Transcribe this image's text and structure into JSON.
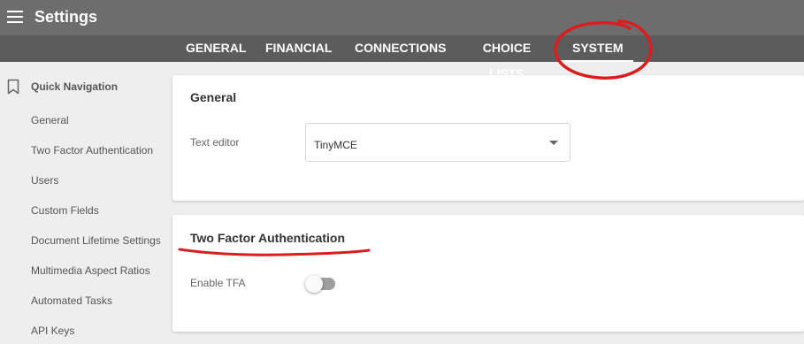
{
  "app": {
    "title": "Settings",
    "menu_icon": "hamburger-menu-icon"
  },
  "tabs": [
    {
      "label": "GENERAL",
      "active": false
    },
    {
      "label": "FINANCIAL",
      "active": false
    },
    {
      "label": "CONNECTIONS",
      "active": false
    },
    {
      "label": "CHOICE LISTS",
      "active": false
    },
    {
      "label": "SYSTEM",
      "active": true
    }
  ],
  "sidebar": {
    "header": {
      "label": "Quick Navigation",
      "icon": "bookmark-icon"
    },
    "items": [
      {
        "label": "General"
      },
      {
        "label": "Two Factor Authentication"
      },
      {
        "label": "Users"
      },
      {
        "label": "Custom Fields"
      },
      {
        "label": "Document Lifetime Settings"
      },
      {
        "label": "Multimedia Aspect Ratios"
      },
      {
        "label": "Automated Tasks"
      },
      {
        "label": "API Keys"
      }
    ]
  },
  "sections": {
    "general": {
      "title": "General",
      "text_editor": {
        "label": "Text editor",
        "value": "TinyMCE"
      }
    },
    "tfa": {
      "title": "Two Factor Authentication",
      "enable": {
        "label": "Enable TFA",
        "enabled": false
      }
    }
  },
  "colors": {
    "topbar": "#6d6d6d",
    "tabbar": "#5c5c5c",
    "background": "#eeeeee",
    "annotation": "#d81e1e"
  }
}
